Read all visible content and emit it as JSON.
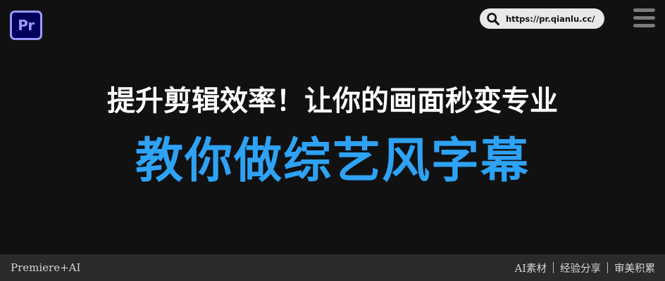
{
  "header": {
    "logo_text": "Pr",
    "url": "https://pr.qianlu.cc/",
    "search_icon": "search-icon",
    "menu_icon": "hamburger-menu-icon"
  },
  "main": {
    "headline": "提升剪辑效率！让你的画面秒变专业",
    "title": "教你做综艺风字幕"
  },
  "footer": {
    "left_label": "Premiere+AI",
    "links": [
      "AI素材",
      "经验分享",
      "审美积累"
    ]
  },
  "colors": {
    "background": "#111111",
    "title_blue": "#2ea2f5",
    "footer_bg": "#2a2a2a",
    "logo_bg": "#00005b",
    "logo_fg": "#9999ff"
  }
}
